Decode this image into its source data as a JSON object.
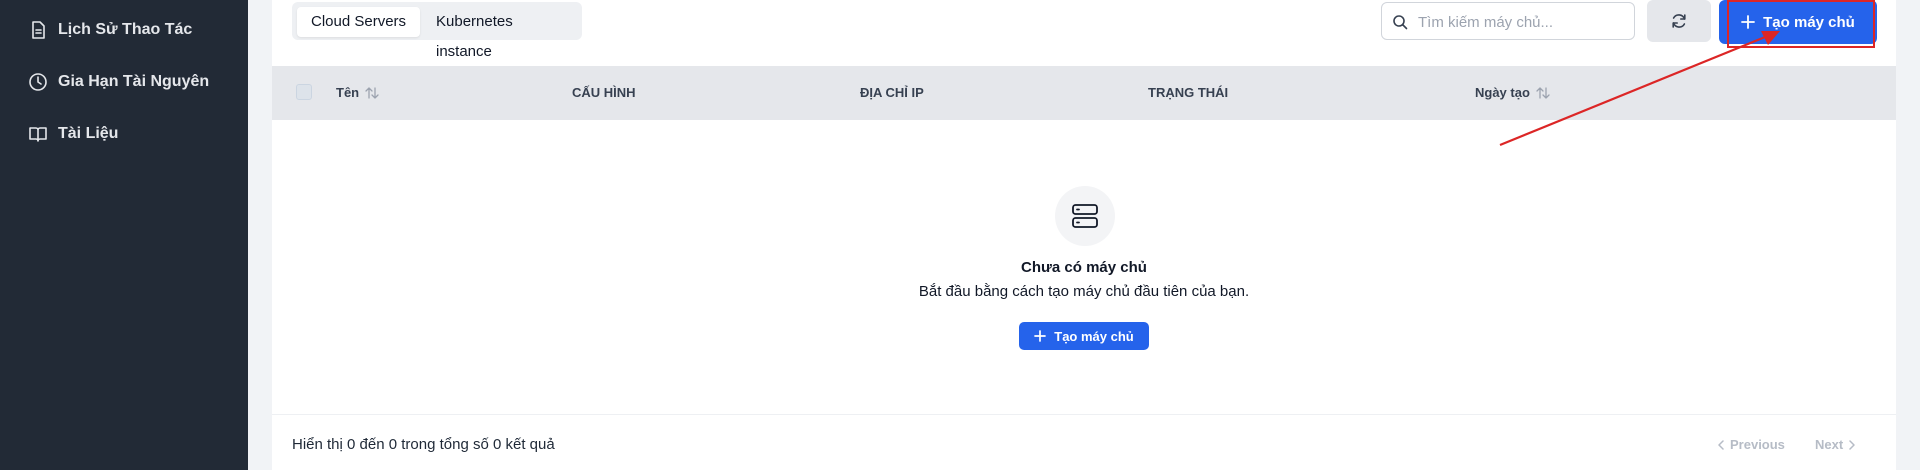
{
  "sidebar": {
    "items": [
      {
        "label": "Lịch Sử Thao Tác",
        "icon": "document-icon"
      },
      {
        "label": "Gia Hạn Tài Nguyên",
        "icon": "clock-icon"
      },
      {
        "label": "Tài Liệu",
        "icon": "book-icon"
      }
    ]
  },
  "tabs": [
    {
      "label": "Cloud Servers",
      "active": true
    },
    {
      "label": "Kubernetes instance",
      "active": false
    }
  ],
  "search": {
    "placeholder": "Tìm kiếm máy chủ...",
    "value": ""
  },
  "toolbar": {
    "create_label": "Tạo máy chủ",
    "refresh_icon": "refresh-icon"
  },
  "table": {
    "columns": [
      "Tên",
      "CẤU HÌNH",
      "ĐỊA CHỈ IP",
      "TRẠNG THÁI",
      "Ngày tạo"
    ],
    "rows": []
  },
  "empty_state": {
    "title": "Chưa có máy chủ",
    "description": "Bắt đầu bằng cách tạo máy chủ đầu tiên của bạn.",
    "button_label": "Tạo máy chủ",
    "icon": "server-icon"
  },
  "footer": {
    "summary": "Hiển thị 0 đến 0 trong tổng số 0 kết quả",
    "previous_label": "Previous",
    "next_label": "Next"
  },
  "colors": {
    "sidebar_bg": "#222a36",
    "primary": "#2563eb",
    "annotation": "#dc2626"
  }
}
